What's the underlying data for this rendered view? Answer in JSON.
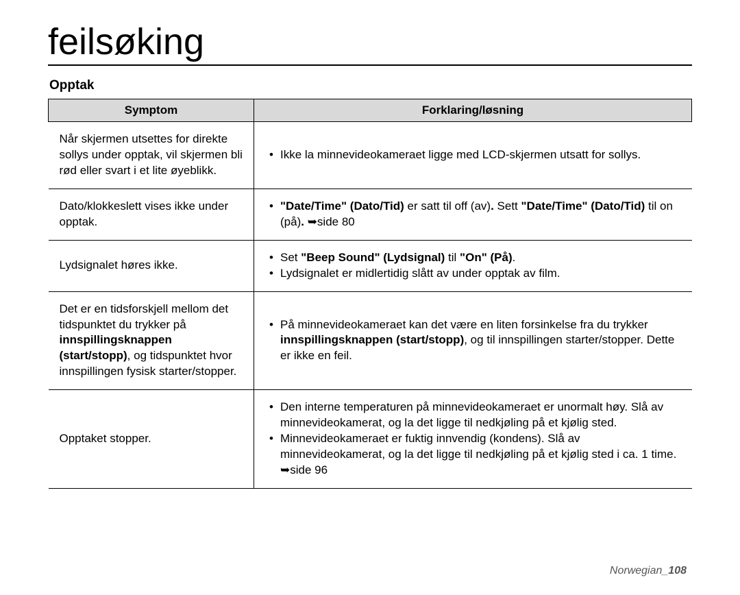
{
  "title": "feilsøking",
  "section_heading": "Opptak",
  "headers": {
    "symptom": "Symptom",
    "explanation": "Forklaring/løsning"
  },
  "rows": [
    {
      "symptom": "Når skjermen utsettes for direkte sollys under opptak, vil skjermen bli rød eller svart i et lite øyeblikk.",
      "items": [
        {
          "parts": [
            {
              "t": "Ikke la minnevideokameraet ligge med LCD-skjermen utsatt for sollys."
            }
          ]
        }
      ]
    },
    {
      "symptom": "Dato/klokkeslett vises ikke under opptak.",
      "items": [
        {
          "parts": [
            {
              "t": "\"Date/Time\" (Dato/Tid)",
              "b": true
            },
            {
              "t": " er satt til off (av)"
            },
            {
              "t": ".",
              "b": true
            },
            {
              "t": " Sett "
            },
            {
              "t": "\"Date/Time\" (Dato/Tid)",
              "b": true
            },
            {
              "t": " til on (på)"
            },
            {
              "t": ". ",
              "b": true
            },
            {
              "t": "➥side 80"
            }
          ]
        }
      ]
    },
    {
      "symptom": "Lydsignalet høres ikke.",
      "items": [
        {
          "parts": [
            {
              "t": "Set "
            },
            {
              "t": "\"Beep Sound\" (Lydsignal)",
              "b": true
            },
            {
              "t": " til "
            },
            {
              "t": "\"On\" (På)",
              "b": true
            },
            {
              "t": "."
            }
          ]
        },
        {
          "parts": [
            {
              "t": "Lydsignalet er midlertidig slått av under opptak av film."
            }
          ]
        }
      ]
    },
    {
      "symptom_parts": [
        {
          "t": "Det er en tidsforskjell mellom det tidspunktet du trykker på "
        },
        {
          "t": "innspillingsknappen (start/stopp)",
          "b": true
        },
        {
          "t": ", og tidspunktet hvor innspillingen fysisk starter/stopper."
        }
      ],
      "items": [
        {
          "parts": [
            {
              "t": "På minnevideokameraet kan det være en liten forsinkelse fra du trykker "
            },
            {
              "t": "innspillingsknappen (start/stopp)",
              "b": true
            },
            {
              "t": ", og til innspillingen starter/stopper. Dette er ikke en feil."
            }
          ]
        }
      ]
    },
    {
      "symptom": "Opptaket stopper.",
      "items": [
        {
          "parts": [
            {
              "t": "Den interne temperaturen på minnevideokameraet er unormalt høy. Slå av minnevideokamerat, og la det ligge til nedkjøling på et kjølig sted."
            }
          ]
        },
        {
          "parts": [
            {
              "t": "Minnevideokameraet er fuktig innvendig (kondens). Slå av minnevideokamerat, og la det ligge til nedkjøling på et kjølig sted i ca. 1 time. ➥side 96"
            }
          ]
        }
      ]
    }
  ],
  "footer": {
    "lang": "Norwegian",
    "sep": "_",
    "page": "108"
  }
}
